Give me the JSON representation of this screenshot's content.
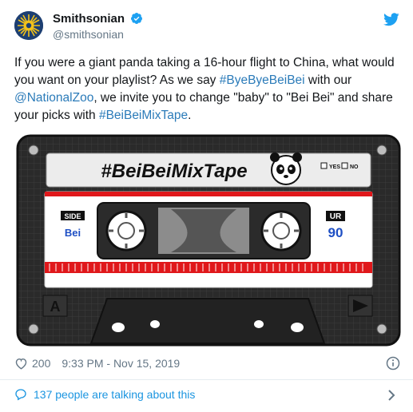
{
  "account": {
    "name": "Smithsonian",
    "handle": "@smithsonian"
  },
  "tweet": {
    "text_part1": "If you were a giant panda taking a 16-hour flight to China, what would you want on your playlist? As we say ",
    "hashtag1": "#ByeByeBeiBei",
    "text_part2": " with our ",
    "mention": "@NationalZoo",
    "text_part3": ", we invite you to change \"baby\" to \"Bei Bei\" and share your picks with ",
    "hashtag2": "#BeiBeiMixTape",
    "text_part4": "."
  },
  "cassette": {
    "label_title": "#BeiBeiMixTape",
    "yes_label": "YES",
    "no_label": "NO",
    "side_label": "SIDE",
    "side_value": "Bei",
    "ur_label": "UR",
    "ur_value": "90",
    "side_letter": "A"
  },
  "meta": {
    "like_count": "200",
    "timestamp": "9:33 PM - Nov 15, 2019"
  },
  "conversation": {
    "label": "137 people are talking about this"
  },
  "colors": {
    "link": "#2b7bb9",
    "twitter_blue": "#1da1f2",
    "cassette_red": "#e0181b",
    "cassette_body": "#1e1e1e"
  }
}
